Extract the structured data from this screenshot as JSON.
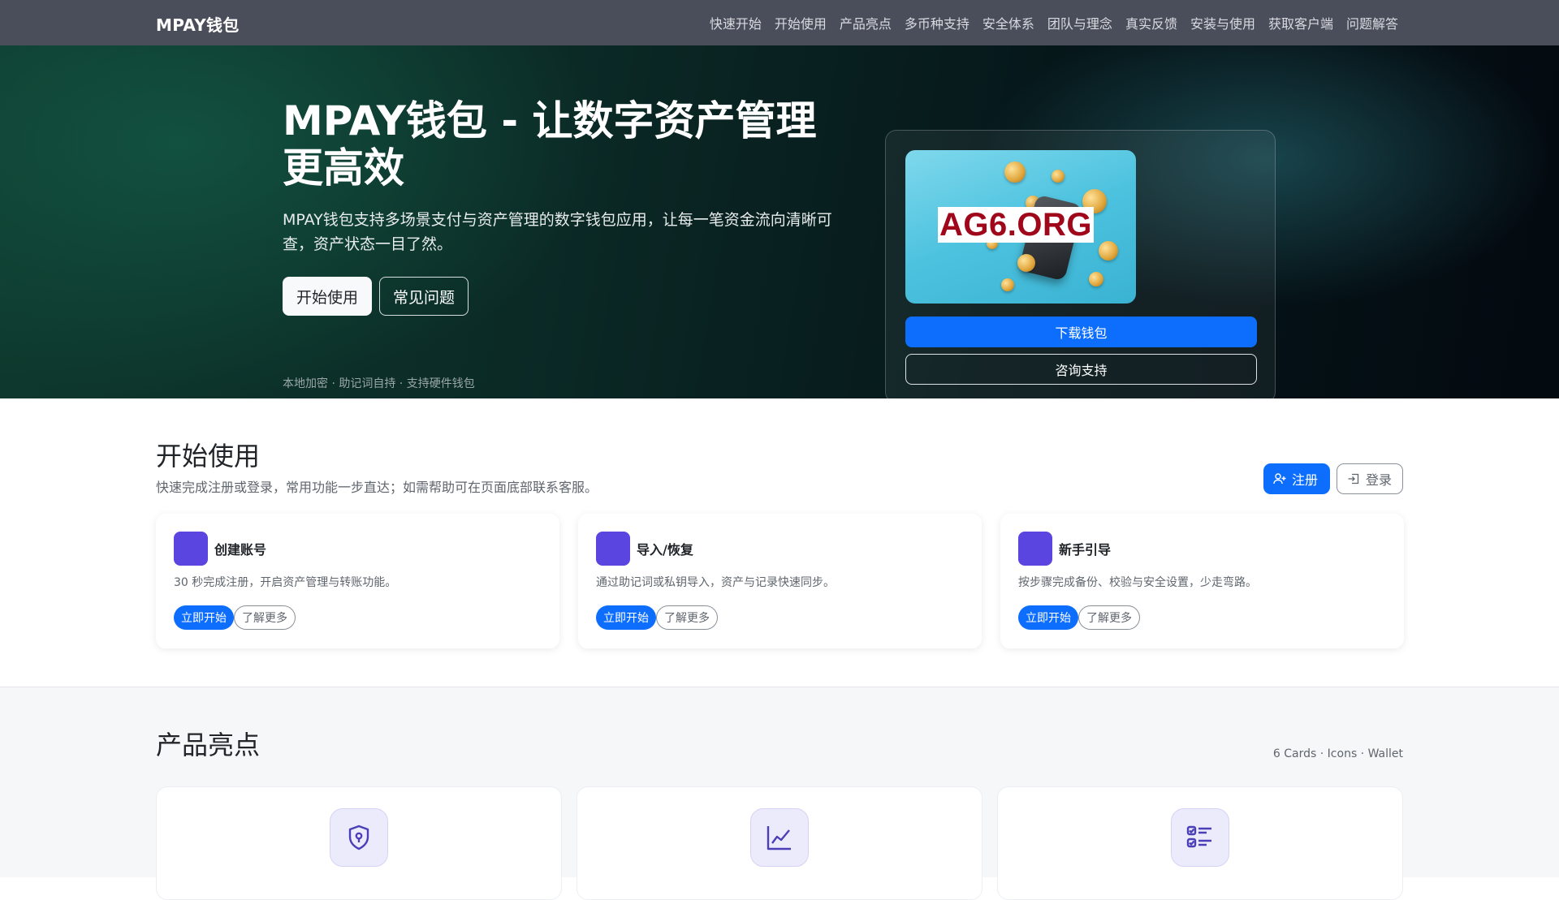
{
  "nav": {
    "brand": "MPAY钱包",
    "links": [
      "快速开始",
      "开始使用",
      "产品亮点",
      "多币种支持",
      "安全体系",
      "团队与理念",
      "真实反馈",
      "安装与使用",
      "获取客户端",
      "问题解答"
    ]
  },
  "hero": {
    "title": "MPAY钱包 - 让数字资产管理更高效",
    "subtitle": "MPAY钱包支持多场景支付与资产管理的数字钱包应用，让每一笔资金流向清晰可查，资产状态一目了然。",
    "primary_button": "开始使用",
    "secondary_button": "常见问题",
    "note": "本地加密 · 助记词自持 · 支持硬件钱包",
    "card": {
      "image_text": "AG6.ORG",
      "download_button": "下载钱包",
      "support_button": "咨询支持"
    }
  },
  "get_started": {
    "title": "开始使用",
    "subtitle": "快速完成注册或登录，常用功能一步直达；如需帮助可在页面底部联系客服。",
    "register_button": "注册",
    "login_button": "登录",
    "cards": [
      {
        "title": "创建账号",
        "desc": "30 秒完成注册，开启资产管理与转账功能。",
        "primary": "立即开始",
        "secondary": "了解更多"
      },
      {
        "title": "导入/恢复",
        "desc": "通过助记词或私钥导入，资产与记录快速同步。",
        "primary": "立即开始",
        "secondary": "了解更多"
      },
      {
        "title": "新手引导",
        "desc": "按步骤完成备份、校验与安全设置，少走弯路。",
        "primary": "立即开始",
        "secondary": "了解更多"
      }
    ]
  },
  "highlights": {
    "title": "产品亮点",
    "meta": "6 Cards · Icons · Wallet",
    "icons": [
      "shield-lock-icon",
      "line-chart-icon",
      "checklist-icon"
    ]
  },
  "colors": {
    "nav_bg": "#4a4d5a",
    "primary": "#0d6efd",
    "accent_purple": "#5b45e0",
    "promo_red": "#a0071b"
  }
}
